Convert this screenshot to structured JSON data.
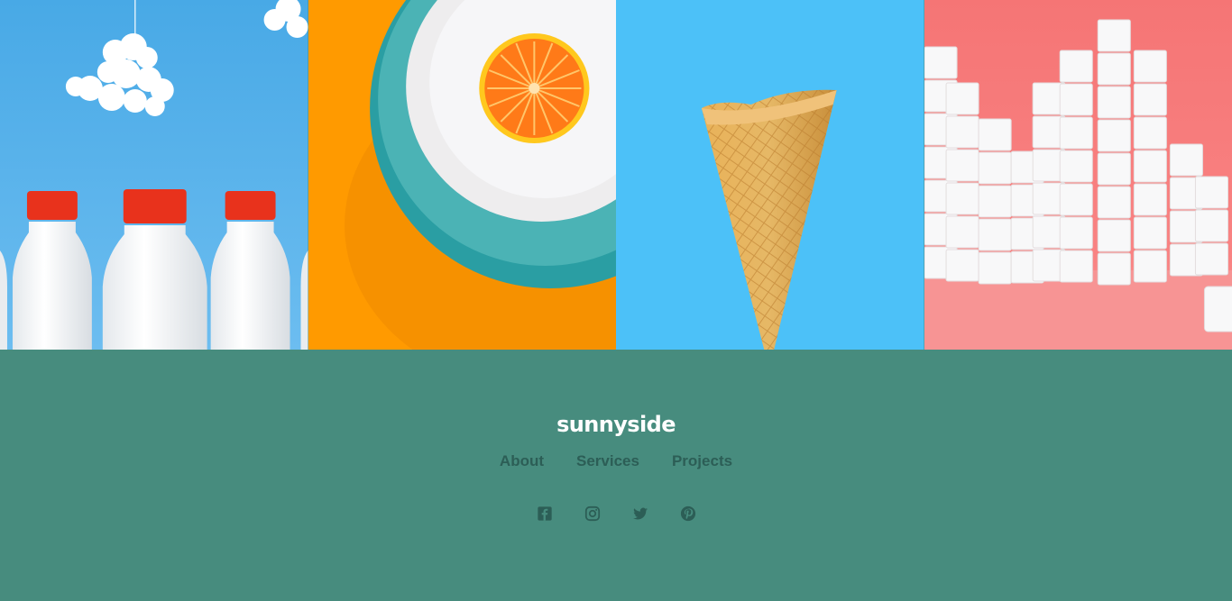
{
  "gallery": {
    "tiles": [
      {
        "name": "milk-bottles-photo",
        "background": "#5FB4EB"
      },
      {
        "name": "orange-plate-photo",
        "background": "#FF9A00"
      },
      {
        "name": "ice-cream-cone-photo",
        "background": "#4CC1F8"
      },
      {
        "name": "sugar-cubes-photo",
        "background": "#F87272"
      }
    ]
  },
  "footer": {
    "logo": "sunnyside",
    "nav": {
      "about": "About",
      "services": "Services",
      "projects": "Projects"
    },
    "social": [
      "facebook-icon",
      "instagram-icon",
      "twitter-icon",
      "pinterest-icon"
    ]
  },
  "colors": {
    "footer_bg": "#478C7E",
    "nav_text": "#2C5E56",
    "logo_text": "#FFFFFF",
    "icon": "#2C5E56"
  }
}
